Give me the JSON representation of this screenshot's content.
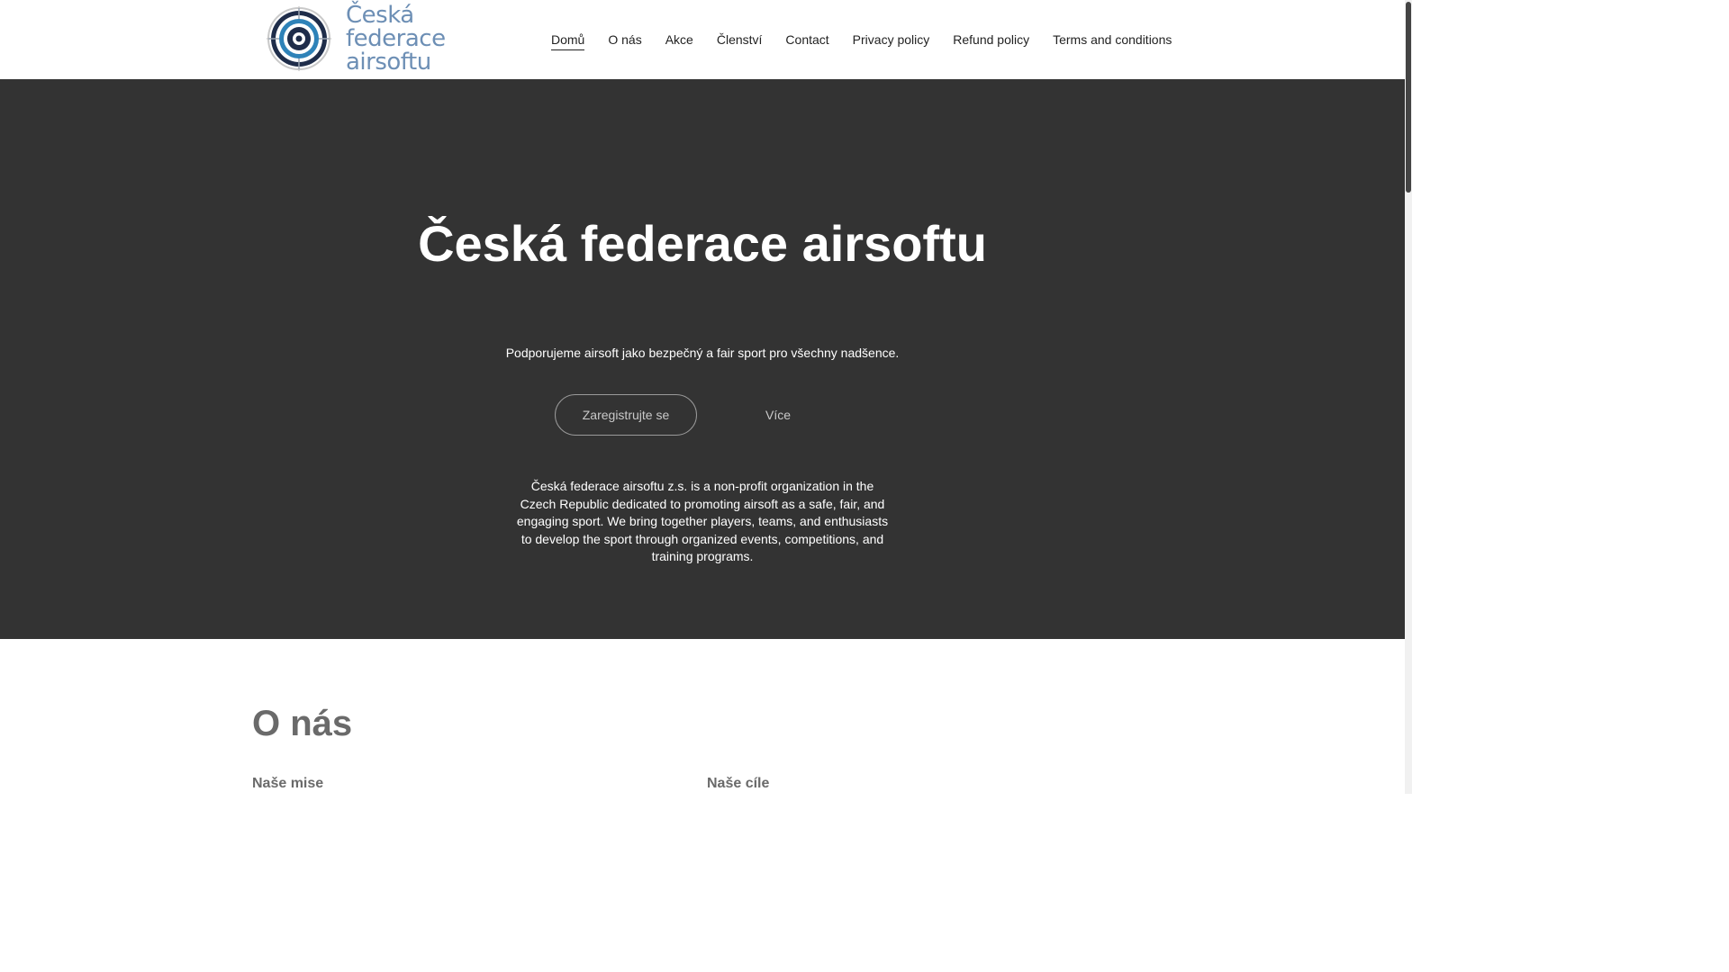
{
  "logo": {
    "line1": "Česká federace",
    "line2": "airsoftu",
    "icon": "target-crosshair-icon",
    "color": "#6d8fb5"
  },
  "nav": {
    "items": [
      {
        "label": "Domů",
        "active": true
      },
      {
        "label": "O nás",
        "active": false
      },
      {
        "label": "Akce",
        "active": false
      },
      {
        "label": "Členství",
        "active": false
      },
      {
        "label": "Contact",
        "active": false
      },
      {
        "label": "Privacy policy",
        "active": false
      },
      {
        "label": "Refund policy",
        "active": false
      },
      {
        "label": "Terms and conditions",
        "active": false
      }
    ]
  },
  "hero": {
    "title": "Česká federace airsoftu",
    "subtitle": "Podporujeme airsoft jako bezpečný a fair sport pro všechny nadšence.",
    "primary_button": "Zaregistrujte se",
    "secondary_button": "Více",
    "description": "Česká federace airsoftu z.s. is a non-profit organization in the Czech Republic dedicated to promoting airsoft as a safe, fair, and engaging sport. We bring together players, teams, and enthusiasts to develop the sport through organized events, competitions, and training programs.",
    "background": "#333333"
  },
  "about": {
    "title": "O nás",
    "col1_heading": "Naše mise",
    "col2_heading": "Naše cíle"
  }
}
